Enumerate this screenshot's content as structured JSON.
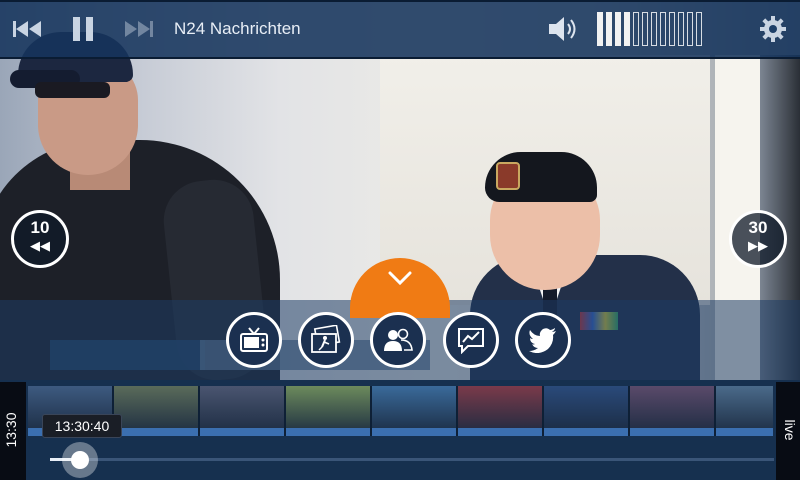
{
  "topbar": {
    "channel_title": "N24 Nachrichten",
    "volume_level": 0.33,
    "volume_segments": 12,
    "icons": [
      "skip-previous-icon",
      "pause-icon",
      "skip-next-icon",
      "speaker-icon",
      "gear-icon"
    ]
  },
  "controls": {
    "rewind_label": "10",
    "forward_label": "30"
  },
  "actions": [
    "tv-icon",
    "photo-gallery-icon",
    "people-icon",
    "chat-chart-icon",
    "twitter-icon"
  ],
  "timeline": {
    "start_time": "13:30",
    "current_time": "13:30:40",
    "live_label": "live",
    "progress": 0.04
  },
  "colors": {
    "accent_orange": "#f07b14",
    "bar_blue": "#16345c"
  }
}
